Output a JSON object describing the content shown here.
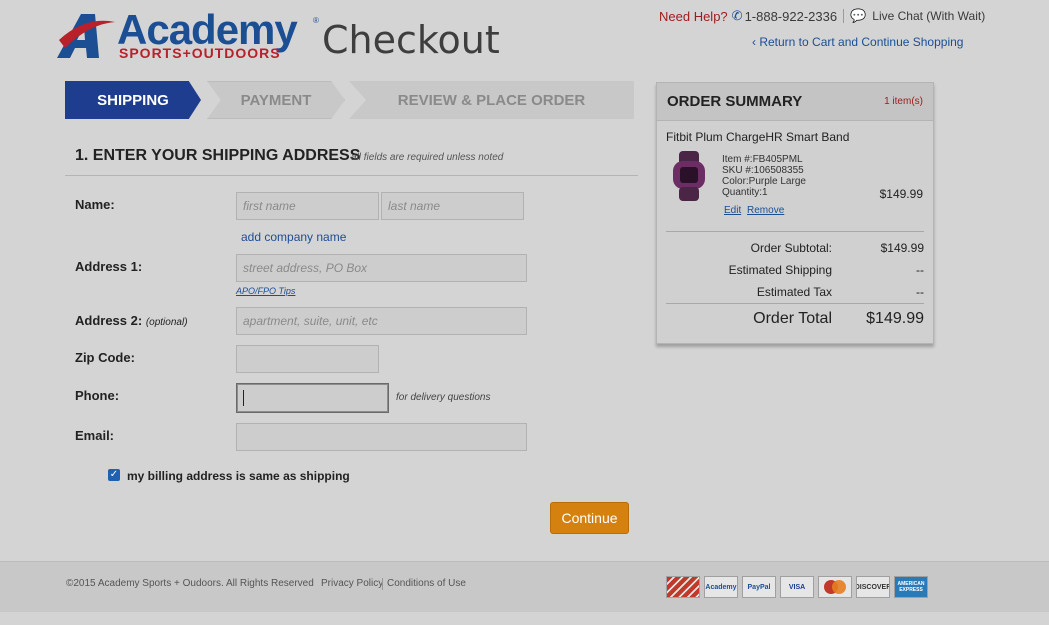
{
  "header": {
    "logo_word": "Academy",
    "logo_sub": "SPORTS+OUTDOORS",
    "logo_reg": "®",
    "page_title": "Checkout",
    "need_help": "Need Help?",
    "phone": "1-888-922-2336",
    "live_chat": "Live Chat (With Wait)",
    "return_link": "‹ Return to Cart and Continue Shopping"
  },
  "steps": [
    {
      "label": "SHIPPING"
    },
    {
      "label": "PAYMENT"
    },
    {
      "label": "REVIEW & PLACE ORDER"
    }
  ],
  "form": {
    "title": "1. ENTER YOUR SHIPPING ADDRESS",
    "note": "all fields are required unless noted",
    "name_label": "Name:",
    "first_name_placeholder": "first name",
    "last_name_placeholder": "last name",
    "add_company": "add company name",
    "address1_label": "Address 1:",
    "address1_placeholder": "street address, PO Box",
    "apo_tips": "APO/FPO Tips",
    "address2_label": "Address 2:",
    "address2_optional": "(optional)",
    "address2_placeholder": "apartment, suite, unit, etc",
    "zip_label": "Zip Code:",
    "phone_label": "Phone:",
    "phone_hint": "for delivery questions",
    "email_label": "Email:",
    "billing_same_label": "my billing address is same as shipping",
    "billing_same_checked": true,
    "continue_label": "Continue"
  },
  "summary": {
    "title": "ORDER SUMMARY",
    "count": "1 item(s)",
    "product_name": "Fitbit Plum ChargeHR Smart Band",
    "item_no": "Item #:FB405PML",
    "sku": "SKU #:106508355",
    "color": "Color:Purple Large",
    "quantity": "Quantity:1",
    "price": "$149.99",
    "edit": "Edit",
    "remove": "Remove",
    "subtotal_label": "Order Subtotal:",
    "subtotal_value": "$149.99",
    "shipping_label": "Estimated Shipping",
    "shipping_value": "--",
    "tax_label": "Estimated Tax",
    "tax_value": "--",
    "total_label": "Order Total",
    "total_value": "$149.99"
  },
  "footer": {
    "copyright": "©2015 Academy Sports + Oudoors. All Rights Reserved",
    "privacy": "Privacy Policy",
    "conditions": "Conditions of Use",
    "payment_icons": [
      {
        "name": "academy-card-icon",
        "label": "",
        "color": "#c0392b"
      },
      {
        "name": "academy-gift-card-icon",
        "label": "Academy",
        "color": "#1c4e94"
      },
      {
        "name": "paypal-icon",
        "label": "PayPal",
        "color": "#1c4e94"
      },
      {
        "name": "visa-icon",
        "label": "VISA",
        "color": "#1a3a8c"
      },
      {
        "name": "mastercard-icon",
        "label": "",
        "color": "#e67e22"
      },
      {
        "name": "discover-icon",
        "label": "DISCOVER",
        "color": "#333333"
      },
      {
        "name": "amex-icon",
        "label": "AMERICAN EXPRESS",
        "color": "#2a7ab8"
      }
    ]
  },
  "colors": {
    "brand_blue": "#1c4e94",
    "brand_red": "#b8202a",
    "continue_orange": "#d4810f",
    "active_step": "#1e3d8f"
  }
}
